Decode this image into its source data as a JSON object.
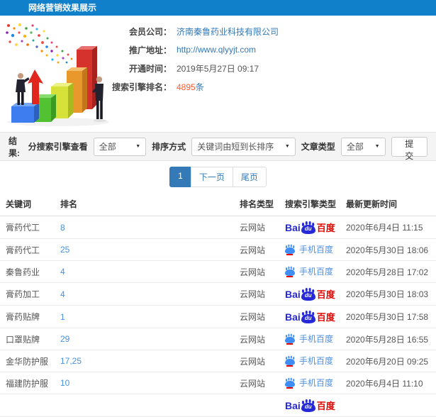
{
  "colors": {
    "header_bg": "#0f80c9",
    "link_blue": "#337ab7",
    "rank_blue": "#4a90d9",
    "highlight_orange": "#ff5a2e",
    "pager_active_bg": "#337ab7",
    "baidu_blue": "#2529d8",
    "baidu_red": "#e10601",
    "mobile_blue": "#3f8ef7",
    "mobile_text_blue": "#4e8fe0"
  },
  "header": {
    "title": "网络营销效果展示"
  },
  "info": {
    "member_label": "会员公司：",
    "member_value": "济南秦鲁药业科技有限公司",
    "url_label": "推广地址：",
    "url_value": "http://www.qlyyjt.com",
    "open_label": "开通时间：",
    "open_value": "2019年5月27日 09:17",
    "rank_label": "搜索引擎排名：",
    "rank_value": "4895",
    "rank_unit": "条"
  },
  "filters": {
    "result_label": "结果:",
    "engine_view_label": "分搜索引擎查看",
    "engine_view_value": "全部",
    "sort_label": "排序方式",
    "sort_value": "关键词由短到长排序",
    "article_label": "文章类型",
    "article_value": "全部",
    "submit_label": "提交"
  },
  "pagination": {
    "current": "1",
    "next_label": "下一页",
    "last_label": "尾页"
  },
  "logos": {
    "baidu": {
      "bai": "Bai",
      "du": "du",
      "cn": "百度"
    },
    "mobile": {
      "label": "手机百度"
    }
  },
  "table": {
    "headers": [
      "关键词",
      "排名",
      "排名类型",
      "搜索引擎类型",
      "最新更新时间"
    ],
    "rows": [
      {
        "keyword": "膏药代工",
        "rank": "8",
        "rank_type": "云网站",
        "engine": "baidu",
        "time": "2020年6月4日 11:15"
      },
      {
        "keyword": "膏药代工",
        "rank": "25",
        "rank_type": "云网站",
        "engine": "mobile",
        "time": "2020年5月30日 18:06"
      },
      {
        "keyword": "秦鲁药业",
        "rank": "4",
        "rank_type": "云网站",
        "engine": "mobile",
        "time": "2020年5月28日 17:02"
      },
      {
        "keyword": "膏药加工",
        "rank": "4",
        "rank_type": "云网站",
        "engine": "baidu",
        "time": "2020年5月30日 18:03"
      },
      {
        "keyword": "膏药贴牌",
        "rank": "1",
        "rank_type": "云网站",
        "engine": "baidu",
        "time": "2020年5月30日 17:58"
      },
      {
        "keyword": "口罩贴牌",
        "rank": "29",
        "rank_type": "云网站",
        "engine": "mobile",
        "time": "2020年5月28日 16:55"
      },
      {
        "keyword": "金华防护服",
        "rank": "17,25",
        "rank_type": "云网站",
        "engine": "mobile",
        "time": "2020年6月20日 09:25"
      },
      {
        "keyword": "福建防护服",
        "rank": "10",
        "rank_type": "云网站",
        "engine": "mobile",
        "time": "2020年6月4日 11:10"
      }
    ],
    "partial_row": {
      "engine": "baidu"
    }
  }
}
